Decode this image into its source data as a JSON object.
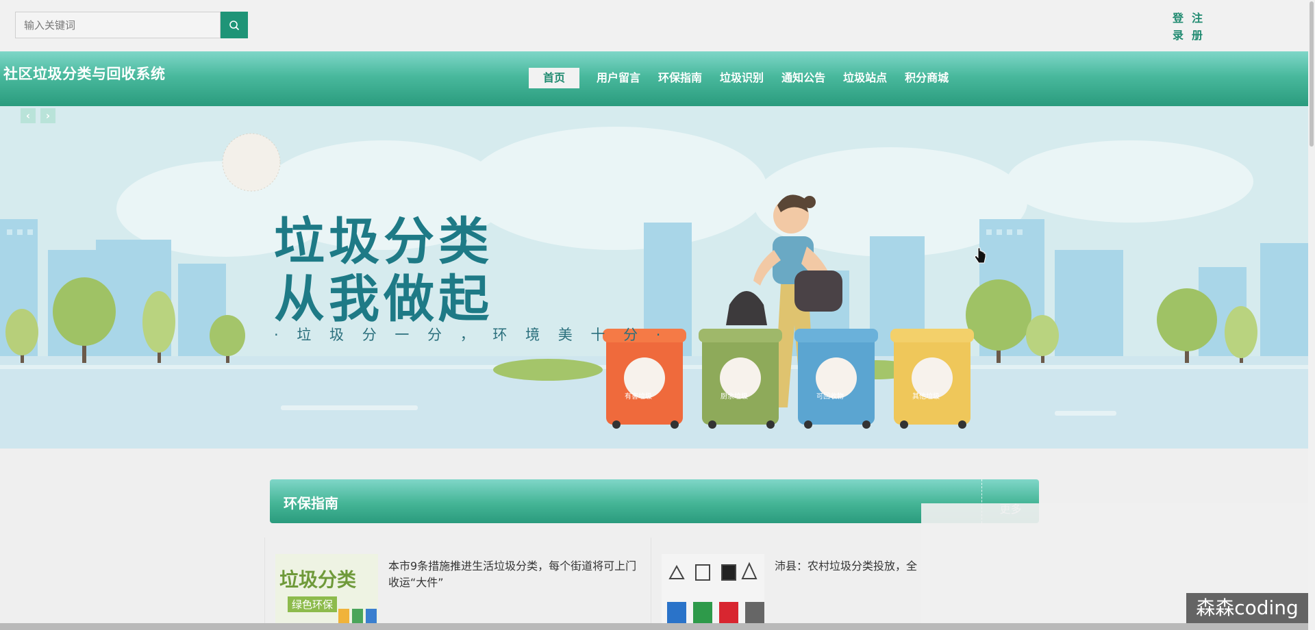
{
  "search": {
    "placeholder": "输入关键词"
  },
  "auth": {
    "login_label_1": "登",
    "login_label_2": "录",
    "register_label_1": "注",
    "register_label_2": "册"
  },
  "header": {
    "site_title": "社区垃圾分类与回收系统"
  },
  "nav": {
    "items": [
      {
        "label": "首页",
        "active": true
      },
      {
        "label": "用户留言"
      },
      {
        "label": "环保指南"
      },
      {
        "label": "垃圾识别"
      },
      {
        "label": "通知公告"
      },
      {
        "label": "垃圾站点"
      },
      {
        "label": "积分商城"
      }
    ]
  },
  "banner": {
    "slogan_line1": "垃圾分类",
    "slogan_line2": "从我做起",
    "slogan_line3": "· 垃 圾 分 一 分 ， 环 境 美 十 分 ·",
    "bin_labels": [
      "有害垃圾",
      "厨余垃圾",
      "可回收物",
      "其他垃圾"
    ],
    "prev_arrow": "‹",
    "next_arrow": "›"
  },
  "section": {
    "title": "环保指南",
    "more_label": "更多",
    "cards": [
      {
        "title": "本市9条措施推进生活垃圾分类，每个街道将可上门收运“大件”",
        "thumb_text": "垃圾分类",
        "thumb_sub": "绿色环保"
      },
      {
        "title": "沛县：农村垃圾分类投放，全"
      }
    ]
  },
  "watermark": "森森coding",
  "colors": {
    "brand": "#1f9477",
    "nav_start": "#7fd6c8",
    "nav_end": "#2a9b7d",
    "slogan": "#1e7a86"
  }
}
